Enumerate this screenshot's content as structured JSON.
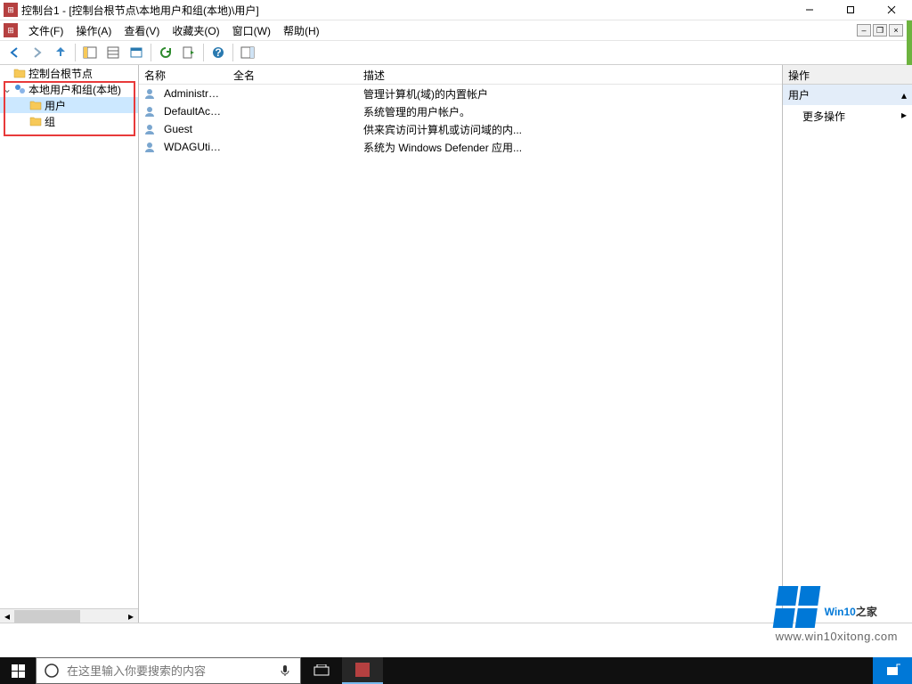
{
  "window": {
    "title": "控制台1 - [控制台根节点\\本地用户和组(本地)\\用户]"
  },
  "menu": {
    "file": "文件(F)",
    "action": "操作(A)",
    "view": "查看(V)",
    "favorites": "收藏夹(O)",
    "window": "窗口(W)",
    "help": "帮助(H)"
  },
  "tree": {
    "root": "控制台根节点",
    "localUsersGroups": "本地用户和组(本地)",
    "users": "用户",
    "groups": "组"
  },
  "list": {
    "columns": {
      "name": "名称",
      "fullname": "全名",
      "description": "描述"
    },
    "rows": [
      {
        "name": "Administrat...",
        "fullname": "",
        "description": "管理计算机(域)的内置帐户"
      },
      {
        "name": "DefaultAcc...",
        "fullname": "",
        "description": "系统管理的用户帐户。"
      },
      {
        "name": "Guest",
        "fullname": "",
        "description": "供来宾访问计算机或访问域的内..."
      },
      {
        "name": "WDAGUtilit...",
        "fullname": "",
        "description": "系统为 Windows Defender 应用..."
      }
    ]
  },
  "actions": {
    "header": "操作",
    "context": "用户",
    "more": "更多操作"
  },
  "taskbar": {
    "searchPlaceholder": "在这里输入你要搜索的内容"
  },
  "watermark": {
    "brand_a": "Win10",
    "brand_b": "之家",
    "url": "www.win10xitong.com"
  }
}
